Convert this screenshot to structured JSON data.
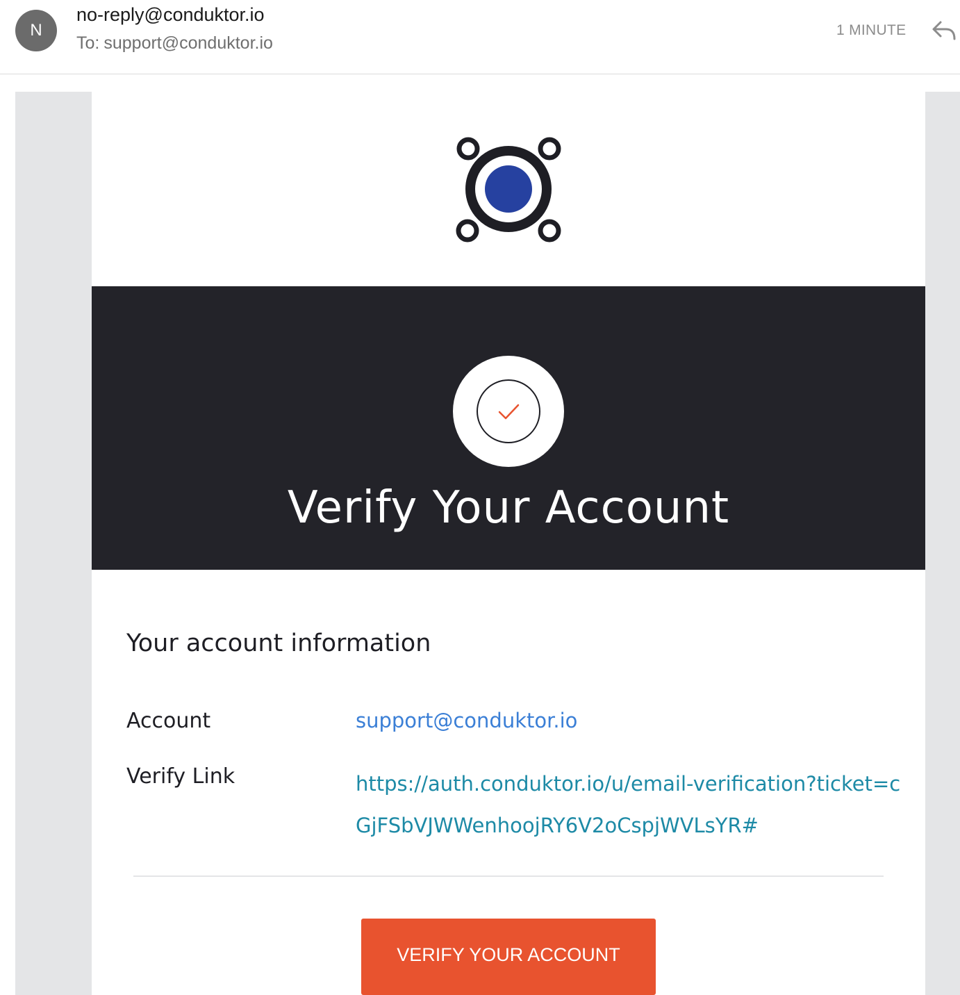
{
  "header": {
    "avatar_initial": "N",
    "sender": "no-reply@conduktor.io",
    "to_label": "To:",
    "recipient": "support@conduktor.io",
    "time": "1 MINUTE",
    "reply_icon": "reply-arrow-icon"
  },
  "email": {
    "logo_icon": "conduktor-logo-icon",
    "banner_icon": "checkmark-icon",
    "banner_title": "Verify Your Account",
    "section_title": "Your account information",
    "rows": [
      {
        "label": "Account",
        "value": "support@conduktor.io"
      },
      {
        "label": "Verify Link",
        "value": "https://auth.conduktor.io/u/email-verification?ticket=cGjFSbVJWWenhoojRY6V2oCspjWVLsYR#"
      }
    ],
    "cta_label": "VERIFY YOUR ACCOUNT"
  },
  "colors": {
    "banner_bg": "#232329",
    "logo_dot": "#2641a0",
    "check_accent": "#e8532f",
    "cta_bg": "#e8532f",
    "account_link": "#3b7fd6",
    "verify_link": "#1d8aa6",
    "outer_bg": "#e4e5e7"
  }
}
